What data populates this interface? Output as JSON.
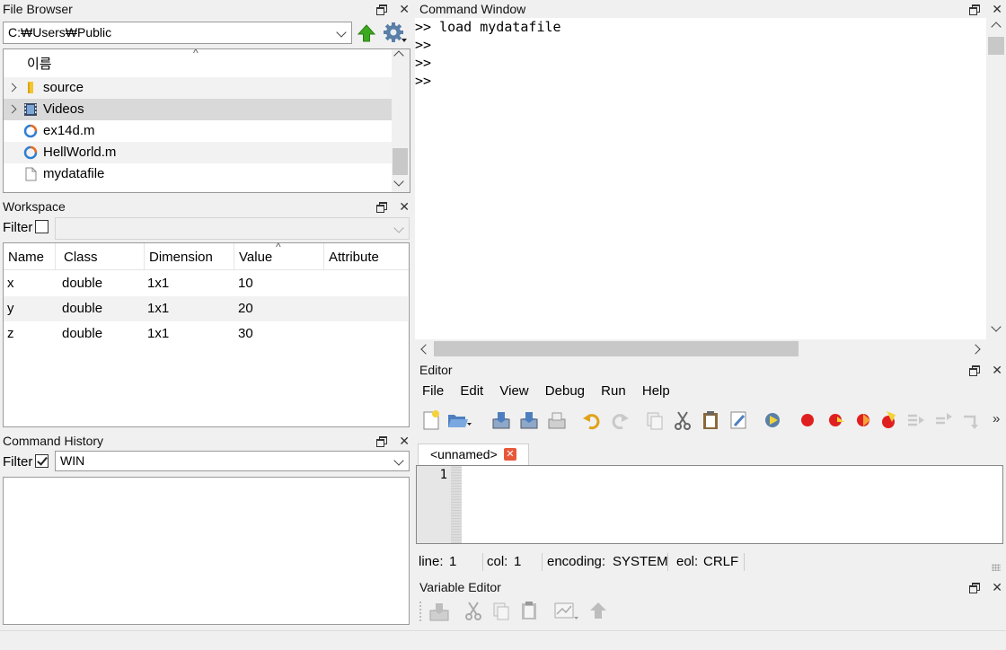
{
  "file_browser": {
    "title": "File Browser",
    "path": "C:₩Users₩Public",
    "column_header": "이름",
    "items": [
      {
        "name": "source",
        "type": "folder-icon"
      },
      {
        "name": "Videos",
        "type": "videos-folder-icon"
      },
      {
        "name": "ex14d.m",
        "type": "matlab-file-icon"
      },
      {
        "name": "HellWorld.m",
        "type": "matlab-file-icon"
      },
      {
        "name": "mydatafile",
        "type": "file-icon"
      }
    ]
  },
  "workspace": {
    "title": "Workspace",
    "filter_label": "Filter",
    "columns": [
      "Name",
      "Class",
      "Dimension",
      "Value",
      "Attribute"
    ],
    "rows": [
      [
        "x",
        "double",
        "1x1",
        "10",
        ""
      ],
      [
        "y",
        "double",
        "1x1",
        "20",
        ""
      ],
      [
        "z",
        "double",
        "1x1",
        "30",
        ""
      ]
    ]
  },
  "command_history": {
    "title": "Command History",
    "filter_label": "Filter",
    "filter_value": "WIN"
  },
  "command_window": {
    "title": "Command Window",
    "lines": [
      ">> load mydatafile",
      ">>",
      ">>",
      ">>"
    ]
  },
  "editor": {
    "title": "Editor",
    "menu": [
      "File",
      "Edit",
      "View",
      "Debug",
      "Run",
      "Help"
    ],
    "tab_label": "<unnamed>",
    "line_number": "1",
    "status": {
      "line_label": "line:",
      "line_value": "1",
      "col_label": "col:",
      "col_value": "1",
      "encoding_label": "encoding:",
      "encoding_value": "SYSTEM",
      "eol_label": "eol:",
      "eol_value": "CRLF"
    }
  },
  "variable_editor": {
    "title": "Variable Editor"
  },
  "colors": {
    "selection": "#d9d9d9",
    "alt_row": "#f2f2f2",
    "red": "#e02020",
    "green_arrow": "#3caa1e"
  }
}
